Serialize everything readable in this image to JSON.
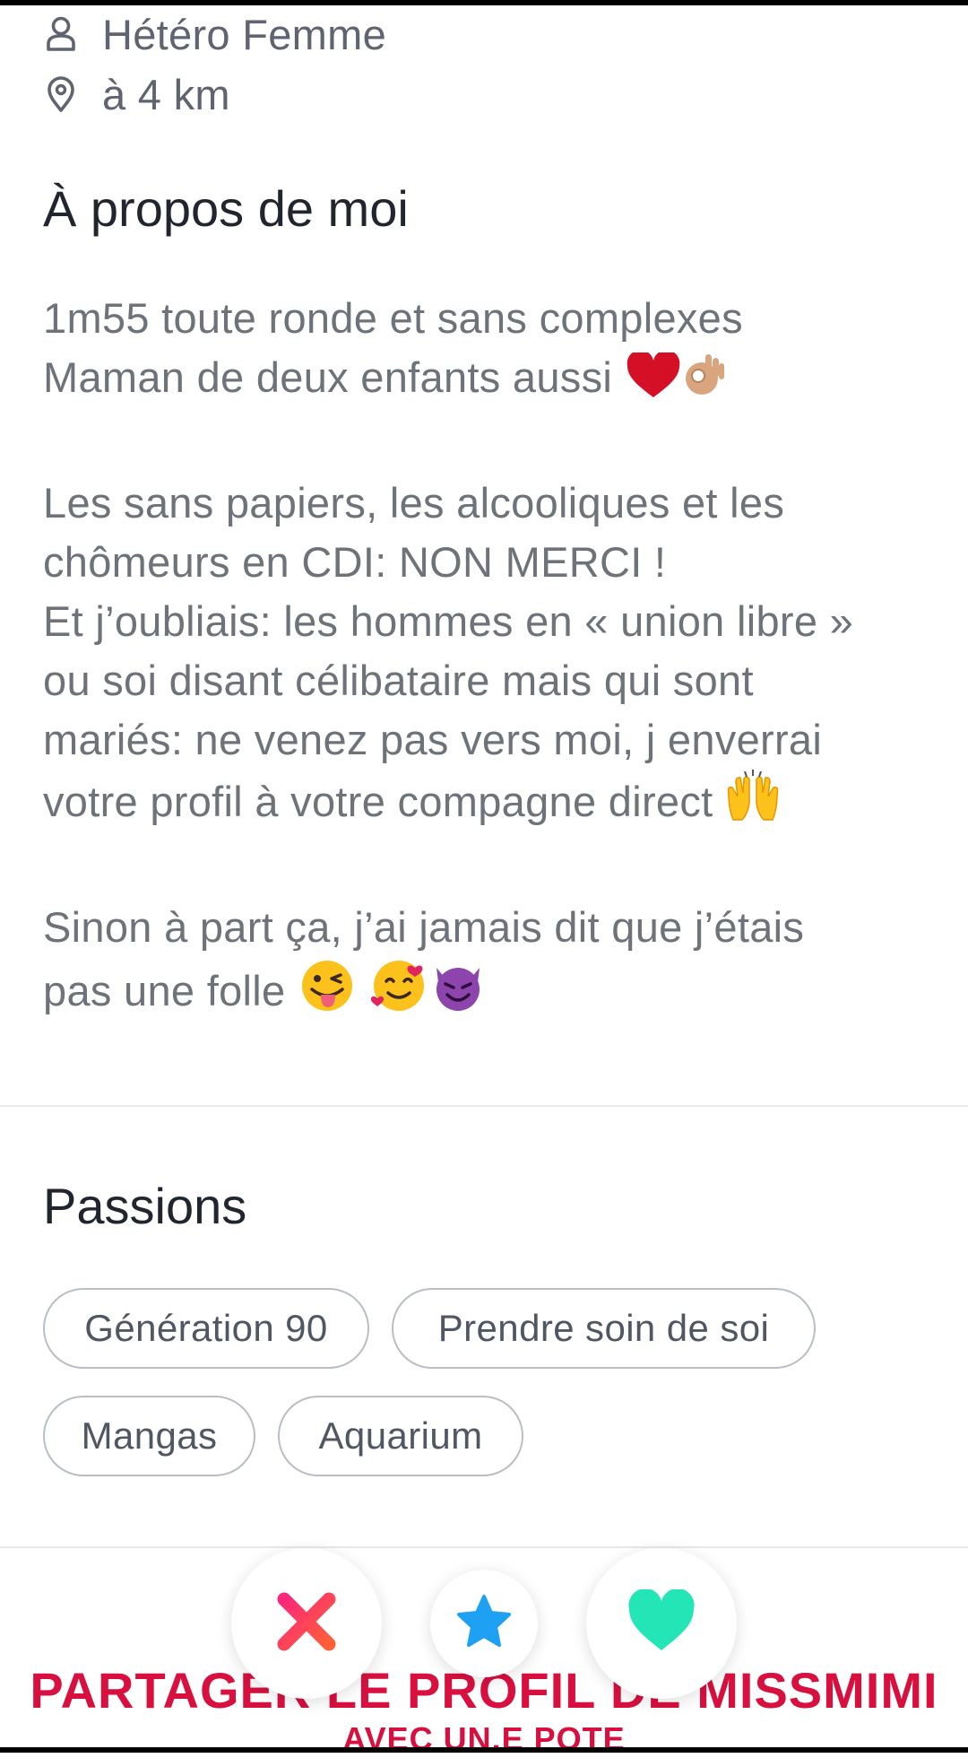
{
  "profile": {
    "orientation": "Hétéro Femme",
    "distance": "à 4 km",
    "orientation_icon": "person-icon",
    "distance_icon": "location-pin-icon"
  },
  "about": {
    "title": "À propos de moi",
    "lines": [
      "1m55 toute ronde et sans complexes",
      "Maman de deux enfants aussi",
      "Les sans papiers, les alcooliques et les",
      "chômeurs en CDI: NON MERCI !",
      "Et j’oubliais: les hommes en « union libre »",
      "ou soi disant célibataire mais qui sont",
      "mariés: ne venez pas vers moi, j enverrai",
      "votre profil à votre compagne direct",
      "Sinon à part ça, j’ai jamais dit que j’étais",
      "pas une folle"
    ],
    "emoji_icons": [
      "red-heart-emoji",
      "ok-hand-emoji",
      "raising-hands-emoji",
      "winking-tongue-emoji",
      "smiling-hearts-emoji",
      "smiling-devil-emoji"
    ]
  },
  "passions": {
    "title": "Passions",
    "chips": [
      "Génération 90",
      "Prendre soin de soi",
      "Mangas",
      "Aquarium"
    ]
  },
  "share": {
    "line1": "PARTAGER LE PROFIL DE MISSMIMI",
    "line2": "AVEC UN.E POTE"
  },
  "actions": {
    "nope_icon": "close-icon",
    "super_like_icon": "star-icon",
    "like_icon": "heart-icon"
  },
  "colors": {
    "accent_red": "#d8103f",
    "nope_gradient": [
      "#fd267a",
      "#ff6036"
    ],
    "star_blue": "#1ea1f2",
    "like_green": "#24e5b5"
  }
}
